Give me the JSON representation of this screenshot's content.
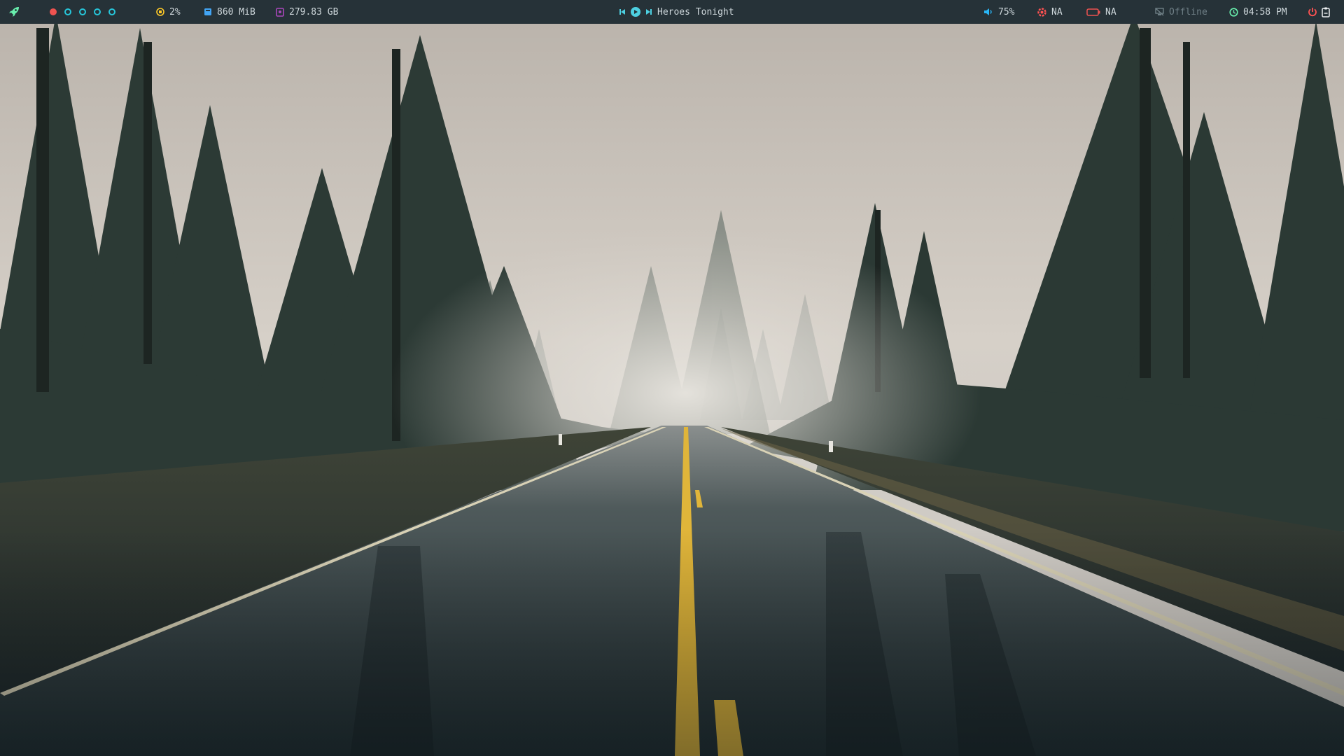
{
  "colors": {
    "bar_bg": "#263238",
    "text": "#cfd8dc",
    "launcher": "#69f0ae",
    "workspace_active": "#ef5350",
    "workspace_idle": "#26c6da",
    "cpu": "#ffca28",
    "memory": "#42a5f5",
    "filesystem": "#ab47bc",
    "media": "#4dd0e1",
    "volume": "#29b6f6",
    "temperature": "#ff5252",
    "battery": "#ef5350",
    "network": "#6f7f86",
    "clock": "#69f0ae",
    "power": "#ff5252"
  },
  "topbar": {
    "launcher": {
      "icon": "rocket-icon"
    },
    "workspaces": [
      {
        "state": "active"
      },
      {
        "state": "idle"
      },
      {
        "state": "idle"
      },
      {
        "state": "idle"
      },
      {
        "state": "idle"
      }
    ],
    "cpu": {
      "icon": "cpu-icon",
      "value": "2%"
    },
    "memory": {
      "icon": "memory-icon",
      "value": "860 MiB"
    },
    "filesystem": {
      "icon": "disk-icon",
      "value": "279.83 GB"
    },
    "media": {
      "prev_icon": "skip-previous-icon",
      "play_icon": "play-circle-icon",
      "next_icon": "skip-next-icon",
      "title": "Heroes Tonight"
    },
    "volume": {
      "icon": "volume-icon",
      "value": "75%"
    },
    "temperature": {
      "icon": "temperature-icon",
      "value": "NA"
    },
    "battery": {
      "icon": "battery-icon",
      "value": "NA"
    },
    "network": {
      "icon": "network-offline-icon",
      "value": "Offline"
    },
    "clock": {
      "icon": "clock-icon",
      "value": "04:58 PM"
    },
    "power": {
      "icon": "power-icon"
    },
    "clipboard": {
      "icon": "clipboard-icon"
    }
  }
}
